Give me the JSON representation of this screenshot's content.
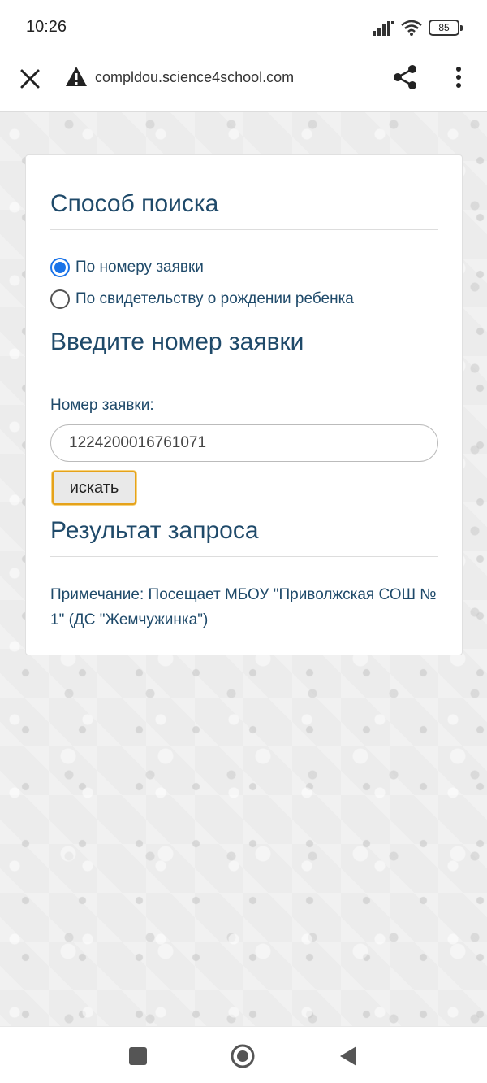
{
  "status_bar": {
    "time": "10:26",
    "battery": "85"
  },
  "browser": {
    "url": "compldou.science4school.com",
    "icons": [
      "close-icon",
      "warning-icon",
      "share-icon",
      "more-vert-icon"
    ]
  },
  "form": {
    "search_method_title": "Способ поиска",
    "radio_options": [
      {
        "label": "По номеру заявки",
        "checked": true
      },
      {
        "label": "По свидетельству о рождении ребенка",
        "checked": false
      }
    ],
    "enter_number_title": "Введите номер заявки",
    "field_label": "Номер заявки:",
    "field_value": "1224200016761071",
    "search_button": "искать",
    "result_title": "Результат запроса",
    "note": "Примечание: Посещает МБОУ \"Приволжская СОШ № 1\" (ДС \"Жемчужинка\")"
  },
  "colors": {
    "accent": "#1a73e8",
    "heading": "#1f4a6a",
    "button_border": "#e5a21b"
  },
  "nav": {
    "icons": [
      "recents-square-icon",
      "home-circle-icon",
      "back-triangle-icon"
    ]
  }
}
